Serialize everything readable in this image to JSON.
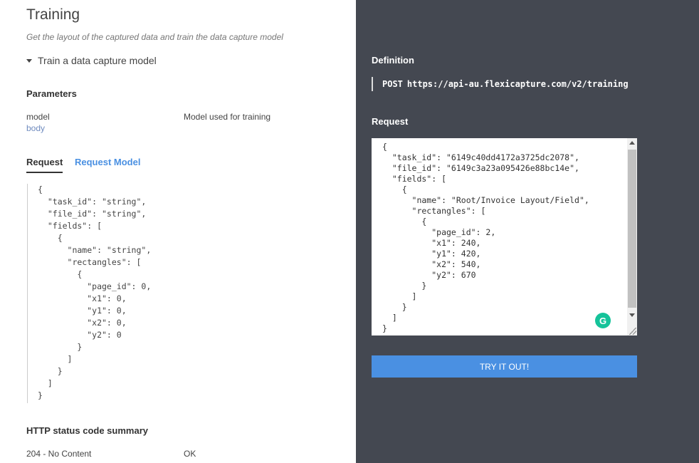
{
  "page": {
    "title": "Training",
    "subtitle": "Get the layout of the captured data and train the data capture model",
    "collapse_label": "Train a data capture model"
  },
  "parameters": {
    "heading": "Parameters",
    "items": [
      {
        "name": "model",
        "location": "body",
        "description": "Model used for training"
      }
    ]
  },
  "tabs": [
    {
      "label": "Request",
      "active": true
    },
    {
      "label": "Request Model",
      "active": false
    }
  ],
  "request_example": "{\n  \"task_id\": \"string\",\n  \"file_id\": \"string\",\n  \"fields\": [\n    {\n      \"name\": \"string\",\n      \"rectangles\": [\n        {\n          \"page_id\": 0,\n          \"x1\": 0,\n          \"y1\": 0,\n          \"x2\": 0,\n          \"y2\": 0\n        }\n      ]\n    }\n  ]\n}",
  "status_summary": {
    "heading": "HTTP status code summary",
    "items": [
      {
        "code": "204 - No Content",
        "description": "OK"
      }
    ]
  },
  "definition": {
    "label": "Definition",
    "method": "POST",
    "url": "https://api-au.flexicapture.com/v2/training"
  },
  "request_editor": {
    "label": "Request",
    "body": "{\n  \"task_id\": \"6149c40dd4172a3725dc2078\",\n  \"file_id\": \"6149c3a23a095426e88bc14e\",\n  \"fields\": [\n    {\n      \"name\": \"Root/Invoice Layout/Field\",\n      \"rectangles\": [\n        {\n          \"page_id\": 2,\n          \"x1\": 240,\n          \"y1\": 420,\n          \"x2\": 540,\n          \"y2\": 670\n        }\n      ]\n    }\n  ]\n}",
    "grammarly_glyph": "G"
  },
  "try_button": {
    "label": "TRY IT OUT!"
  },
  "colors": {
    "right_panel_bg": "#444851",
    "accent": "#4a90e2",
    "grammarly": "#15c39a"
  }
}
